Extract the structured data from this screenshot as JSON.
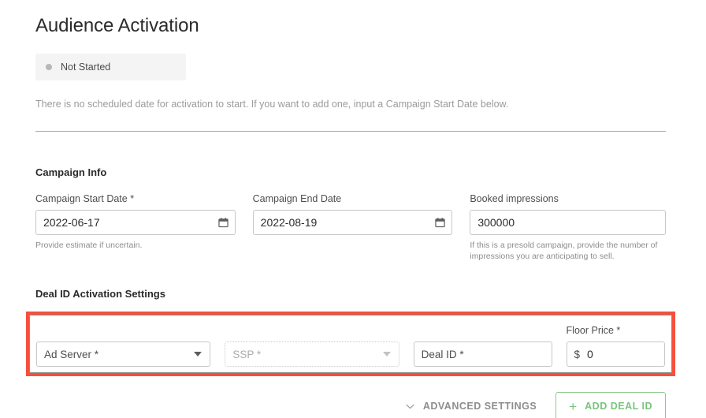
{
  "page": {
    "title": "Audience Activation"
  },
  "status": {
    "label": "Not Started",
    "dot_color": "#b7b7b7",
    "background": "#f4f4f4"
  },
  "description": "There is no scheduled date for activation to start. If you want to add one, input a Campaign Start Date below.",
  "campaign_info": {
    "heading": "Campaign Info",
    "start_date": {
      "label": "Campaign Start Date *",
      "value": "2022-06-17",
      "helper": "Provide estimate if uncertain.",
      "icon": "calendar-icon"
    },
    "end_date": {
      "label": "Campaign End Date",
      "value": "2022-08-19",
      "icon": "calendar-icon"
    },
    "booked_impressions": {
      "label": "Booked impressions",
      "value": "300000",
      "helper": "If this is a presold campaign, provide the number of impressions you are anticipating to sell."
    }
  },
  "deal_settings": {
    "heading": "Deal ID Activation Settings",
    "highlight_color": "#f4503c",
    "ad_server": {
      "placeholder": "Ad Server *",
      "value": "",
      "disabled": false
    },
    "ssp": {
      "placeholder": "SSP *",
      "value": "",
      "disabled": true
    },
    "deal_id": {
      "placeholder": "Deal ID *",
      "value": ""
    },
    "floor_price": {
      "label": "Floor Price *",
      "currency": "$",
      "value": "0"
    }
  },
  "actions": {
    "advanced_settings_label": "ADVANCED SETTINGS",
    "advanced_settings_icon": "chevron-down-icon",
    "add_deal_id_label": "ADD DEAL ID",
    "add_deal_id_icon": "plus-icon",
    "accent_green": "#7ac47f"
  }
}
